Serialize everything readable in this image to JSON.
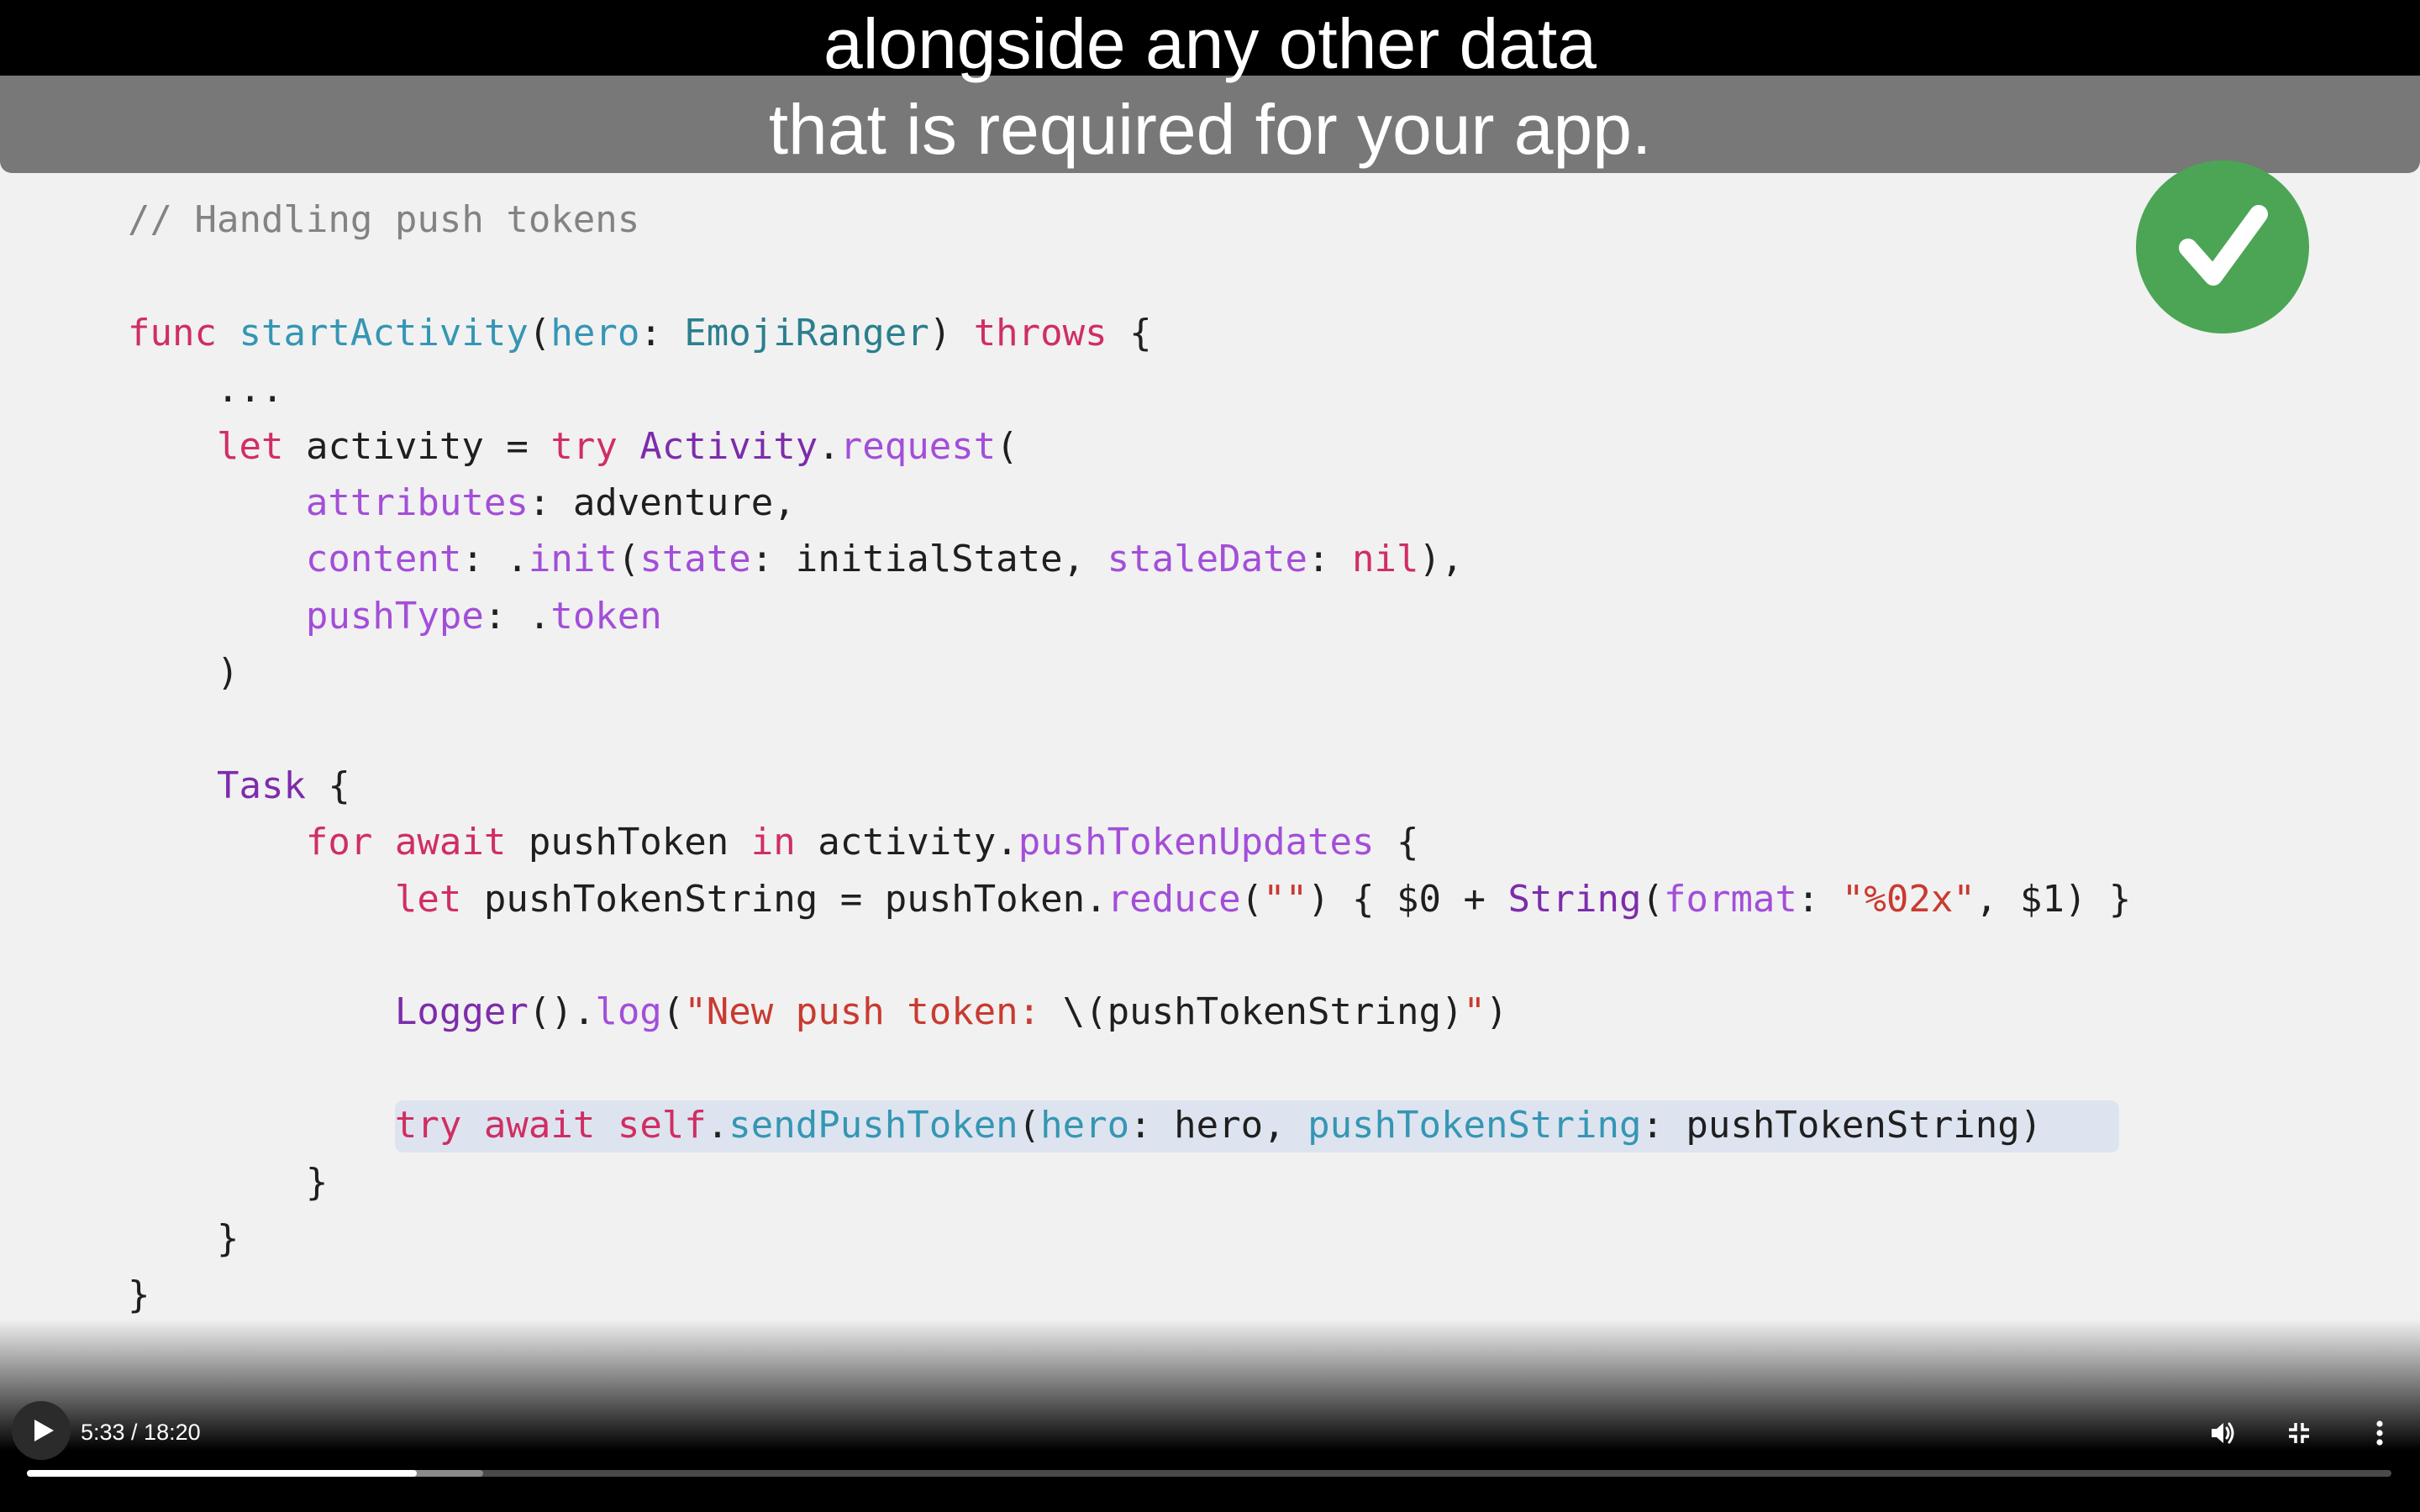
{
  "caption": {
    "line1": "alongside any other data",
    "line2": "that is required for your app."
  },
  "badge": {
    "icon": "checkmark-icon",
    "color": "#4ca555"
  },
  "code": {
    "comment": "// Handling push tokens",
    "l_func": "func",
    "l_fname": "startActivity",
    "l_param_hero": "hero",
    "l_type": "EmojiRanger",
    "l_throws": "throws",
    "l_ellipsis": "...",
    "l_let": "let",
    "l_activity": "activity",
    "l_try": "try",
    "l_Activity": "Activity",
    "l_request": "request",
    "l_attributes": "attributes",
    "l_adventure": "adventure,",
    "l_content": "content",
    "l_init": "init",
    "l_state": "state",
    "l_initialState": "initialState,",
    "l_staleDate": "staleDate",
    "l_nil": "nil",
    "l_pushType": "pushType",
    "l_token": "token",
    "l_Task": "Task",
    "l_for": "for",
    "l_await": "await",
    "l_pushToken": "pushToken",
    "l_in": "in",
    "l_pushTokenUpdates": "pushTokenUpdates",
    "l_pushTokenString": "pushTokenString",
    "l_reduce": "reduce",
    "l_empty": "\"\"",
    "l_dollar0": "$0",
    "l_String": "String",
    "l_format": "format",
    "l_fmtstr": "\"%02x\"",
    "l_dollar1": "$1",
    "l_Logger": "Logger",
    "l_log": "log",
    "l_newpush": "\"New push token: ",
    "l_interp": "\\(pushTokenString)",
    "l_quote": "\"",
    "l_self": "self",
    "l_sendPushToken": "sendPushToken",
    "l_hero_arg": "hero,"
  },
  "player": {
    "time": "5:33 / 18:20",
    "progress_played": 0.165,
    "progress_buffered": 0.193,
    "play_icon": "play-icon",
    "volume_icon": "volume-icon",
    "fullscreen_icon": "exit-fullscreen-icon",
    "more_icon": "more-options-icon"
  }
}
